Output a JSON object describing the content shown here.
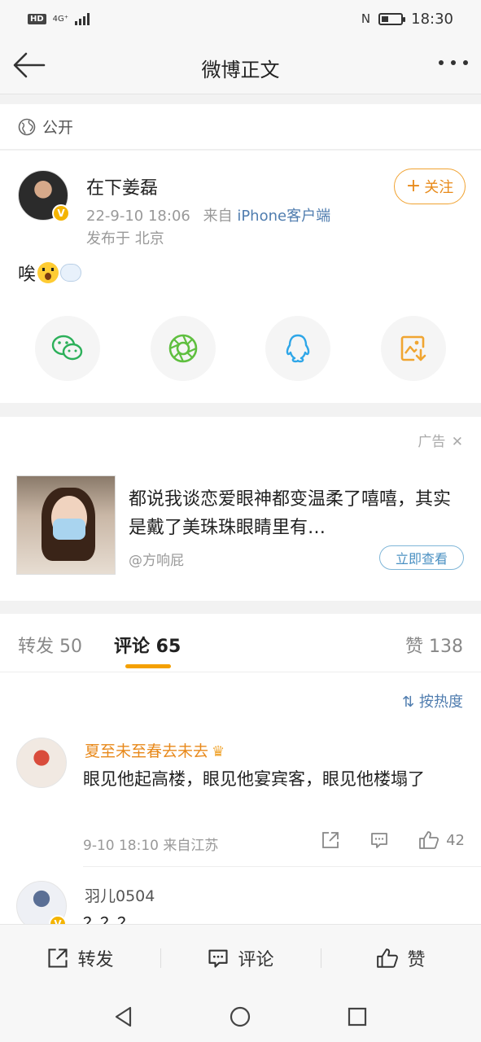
{
  "status_bar": {
    "hd": "HD",
    "signal": "4G⁺",
    "time": "18:30",
    "nfc": "N",
    "battery_level": 0.35
  },
  "nav": {
    "title": "微博正文"
  },
  "visibility": {
    "label": "公开"
  },
  "post": {
    "author": "在下姜磊",
    "verified_badge": "V",
    "time": "22-9-10 18:06",
    "from_prefix": "来自",
    "source": "iPhone客户端",
    "location": "发布于 北京",
    "follow_label": "关注",
    "text": "唉"
  },
  "ad": {
    "label": "广告",
    "title": "都说我谈恋爱眼神都变温柔了嘻嘻，其实是戴了美珠珠眼睛里有…",
    "source": "@方响屁",
    "cta": "立即查看"
  },
  "tabs": {
    "repost": "转发 50",
    "comment": "评论 65",
    "like": "赞 138"
  },
  "sort": {
    "label": "按热度"
  },
  "comments": [
    {
      "user": "夏至未至春去未去",
      "text": "眼见他起高楼，眼见他宴宾客，眼见他楼塌了",
      "meta": "9-10 18:10 来自江苏",
      "likes": "42"
    },
    {
      "user": "羽儿0504",
      "text": "？？？",
      "badge": "V"
    }
  ],
  "action_bar": {
    "repost": "转发",
    "comment": "评论",
    "like": "赞"
  },
  "colors": {
    "accent": "#f4a000",
    "link": "#507daf",
    "follow": "#e88a1a"
  }
}
